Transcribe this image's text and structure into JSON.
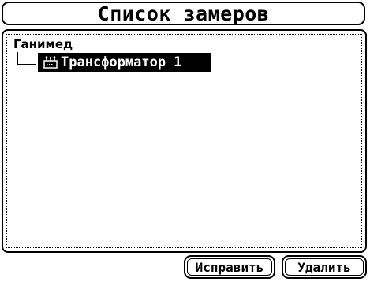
{
  "window": {
    "title": "Список замеров"
  },
  "tree": {
    "root_label": "Ганимед",
    "children": [
      {
        "label": "Трансформатор 1",
        "selected": true,
        "icon": "transformer-icon"
      }
    ]
  },
  "buttons": {
    "edit_label": "Исправить",
    "delete_label": "Удалить"
  },
  "colors": {
    "foreground": "#000000",
    "background": "#ffffff",
    "selection_background": "#000000",
    "selection_text": "#ffffff"
  }
}
